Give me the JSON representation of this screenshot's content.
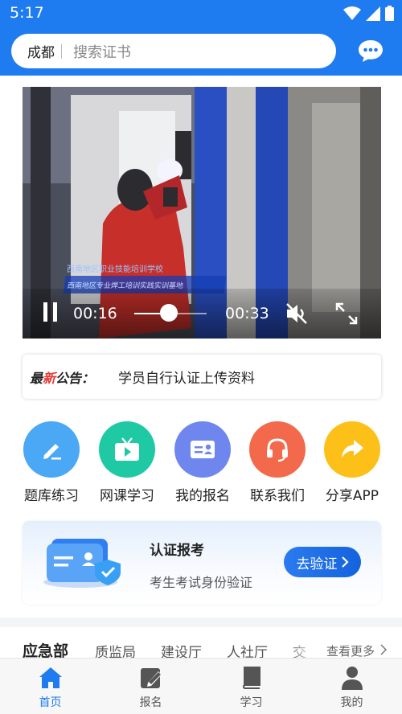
{
  "status_bar": {
    "time": "5:17"
  },
  "search": {
    "city": "成都",
    "placeholder": "搜索证书"
  },
  "video": {
    "current_time": "00:16",
    "total_time": "00:33",
    "progress": 0.48,
    "caption": "西南地区专业焊工培训实践实训基地",
    "logo_text": "西南地区职业技能培训学校"
  },
  "notice": {
    "label_prefix": "最",
    "label_highlight": "新",
    "label_suffix": "公告：",
    "text": "学员自行认证上传资料"
  },
  "quick_actions": [
    {
      "label": "题库练习",
      "icon": "pencil-icon",
      "color": "#4aa8f4"
    },
    {
      "label": "网课学习",
      "icon": "tv-icon",
      "color": "#1ec9a4"
    },
    {
      "label": "我的报名",
      "icon": "id-card-icon",
      "color": "#6f86ef"
    },
    {
      "label": "联系我们",
      "icon": "headset-icon",
      "color": "#f26a4b"
    },
    {
      "label": "分享APP",
      "icon": "share-icon",
      "color": "#fdc018"
    }
  ],
  "cert_card": {
    "title": "认证报考",
    "subtitle": "考生考试身份验证",
    "button": "去验证"
  },
  "categories": {
    "tabs": [
      "应急部",
      "质监局",
      "建设厅",
      "人社厅",
      "交"
    ],
    "active": 0,
    "more": "查看更多"
  },
  "tabbar": [
    {
      "label": "首页",
      "icon": "home-icon",
      "active": true
    },
    {
      "label": "报名",
      "icon": "edit-form-icon",
      "active": false
    },
    {
      "label": "学习",
      "icon": "book-icon",
      "active": false
    },
    {
      "label": "我的",
      "icon": "user-icon",
      "active": false
    }
  ],
  "colors": {
    "primary": "#1e7bf0",
    "notice_red": "#e53935"
  }
}
